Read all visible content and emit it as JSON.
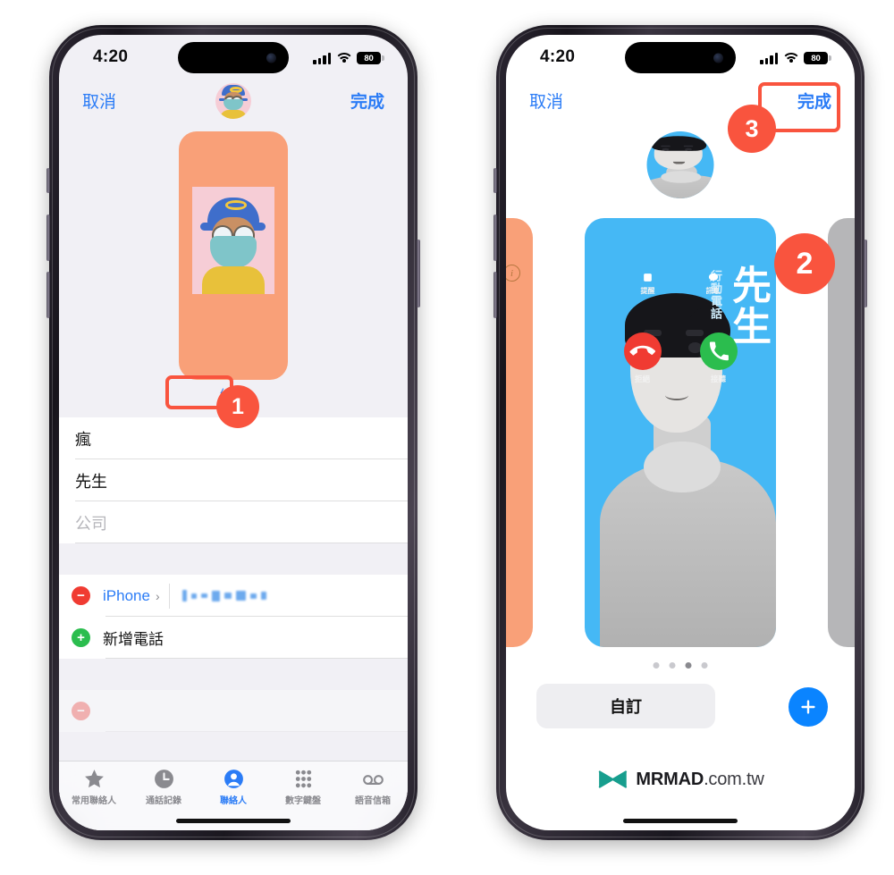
{
  "statusbar": {
    "time": "4:20",
    "battery_level": "80",
    "signal_icon": "cellular-bars-icon",
    "wifi_icon": "wifi-icon",
    "battery_icon": "battery-icon"
  },
  "left_phone": {
    "nav": {
      "cancel": "取消",
      "done": "完成",
      "avatar_icon": "contact-avatar-memoji"
    },
    "poster": {
      "background_color": "#F9A078",
      "edit_label": "編輯"
    },
    "fields": [
      {
        "value": "瘋",
        "is_placeholder": false
      },
      {
        "value": "先生",
        "is_placeholder": false
      },
      {
        "value": "公司",
        "is_placeholder": true
      }
    ],
    "phone_rows": [
      {
        "action_icon": "remove-icon",
        "label": "iPhone",
        "chevron": "›",
        "number": ""
      },
      {
        "action_icon": "add-icon",
        "label": "新增電話",
        "chevron": "",
        "number": ""
      }
    ],
    "tabs": [
      {
        "label": "常用聯絡人",
        "icon": "star-icon",
        "active": false
      },
      {
        "label": "通話記錄",
        "icon": "clock-icon",
        "active": false
      },
      {
        "label": "聯絡人",
        "icon": "person-icon",
        "active": true
      },
      {
        "label": "數字鍵盤",
        "icon": "keypad-icon",
        "active": false
      },
      {
        "label": "語音信箱",
        "icon": "voicemail-icon",
        "active": false
      }
    ],
    "annotation": {
      "badge": "1",
      "highlight_color": "#F9543E"
    }
  },
  "right_phone": {
    "nav": {
      "cancel": "取消",
      "done": "完成",
      "avatar_icon": "contact-avatar-photo"
    },
    "poster": {
      "background_color": "#45B8F5",
      "name": "先生",
      "subtitle": "行動電話",
      "call_actions": [
        {
          "label": "提醒",
          "icon": "reminder-icon"
        },
        {
          "label": "訊息",
          "icon": "message-icon"
        }
      ],
      "answer_actions": [
        {
          "label": "拒絕",
          "icon": "decline-call-icon",
          "color": "#f03b32"
        },
        {
          "label": "接聽",
          "icon": "answer-call-icon",
          "color": "#2bbd4e"
        }
      ]
    },
    "peek_cards": [
      {
        "side": "left",
        "color": "#F9A078",
        "icon": "info-icon"
      },
      {
        "side": "right",
        "color": "#b6b6b8",
        "icon": ""
      }
    ],
    "page_dots": {
      "count": 4,
      "active_index": 2
    },
    "customize_label": "自訂",
    "add_button_icon": "plus-icon",
    "annotations": [
      {
        "badge": "2",
        "highlight_color": "#F9543E"
      },
      {
        "badge": "3",
        "highlight_color": "#F9543E"
      }
    ]
  },
  "watermark": {
    "brand": "MRMAD",
    "domain": ".com.tw",
    "logo_icon": "mrmad-logo-icon"
  }
}
